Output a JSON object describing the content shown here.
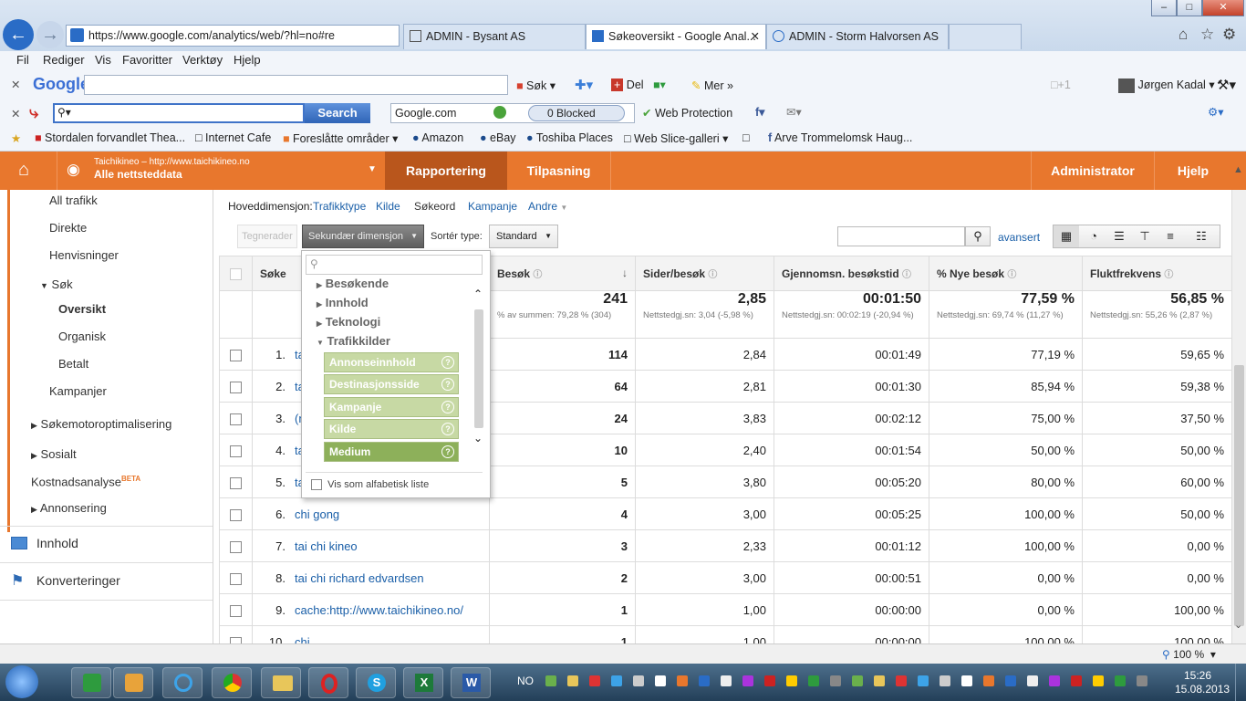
{
  "browser": {
    "address": "https://www.google.com/analytics/web/?hl=no#re",
    "tabs": [
      "ADMIN - Bysant AS",
      "Søkeoversikt - Google Anal...",
      "ADMIN - Storm Halvorsen AS"
    ],
    "menu": [
      "Fil",
      "Rediger",
      "Vis",
      "Favoritter",
      "Verktøy",
      "Hjelp"
    ],
    "google_toolbar": {
      "logo": "Google",
      "search_label": "Søk",
      "share": "Del",
      "more": "Mer",
      "user": "Jørgen Kadal"
    },
    "avg_toolbar": {
      "search_button": "Search",
      "engine": "Google.com",
      "blocked": "0 Blocked",
      "web_protection": "Web Protection"
    },
    "favorites": [
      "Stordalen forvandlet Thea...",
      "Internet Cafe",
      "Foreslåtte områder",
      "Amazon",
      "eBay",
      "Toshiba Places",
      "Web Slice-galleri",
      "Arve Trommelomsk Haug..."
    ]
  },
  "ga_header": {
    "site_line1": "Taichikineo – http://www.taichikineo.no",
    "site_line2": "Alle nettsteddata",
    "tabs": [
      "Rapportering",
      "Tilpasning"
    ],
    "right_tabs": [
      "Administrator",
      "Hjelp"
    ]
  },
  "sidebar": {
    "items": [
      "All trafikk",
      "Direkte",
      "Henvisninger",
      "Søk",
      "Oversikt",
      "Organisk",
      "Betalt",
      "Kampanjer",
      "Søkemotoroptimalisering",
      "Sosialt",
      "Kostnadsanalyse",
      "Annonsering",
      "Innhold",
      "Konverteringer"
    ],
    "beta": "BETA"
  },
  "primary_dim": {
    "label": "Hoveddimensjon:",
    "options": [
      "Trafikktype",
      "Kilde",
      "Søkeord",
      "Kampanje",
      "Andre"
    ]
  },
  "controls": {
    "plot_rows": "Tegnerader",
    "secondary_dim": "Sekundær dimensjon",
    "sort_label": "Sortér type:",
    "sort_value": "Standard",
    "advanced": "avansert"
  },
  "dropdown": {
    "groups": [
      "Besøkende",
      "Innhold",
      "Teknologi",
      "Trafikkilder"
    ],
    "subitems": [
      "Annonseinnhold",
      "Destinasjonsside",
      "Kampanje",
      "Kilde",
      "Medium"
    ],
    "alpha_list": "Vis som alfabetisk liste"
  },
  "table": {
    "headers": [
      "Søke",
      "Besøk",
      "Sider/besøk",
      "Gjennomsn. besøkstid",
      "% Nye besøk",
      "Fluktfrekvens"
    ],
    "totals": [
      {
        "big": "241",
        "small": "% av summen: 79,28 % (304)"
      },
      {
        "big": "2,85",
        "small": "Nettstedgj.sn: 3,04 (-5,98 %)"
      },
      {
        "big": "00:01:50",
        "small": "Nettstedgj.sn: 00:02:19 (-20,94 %)"
      },
      {
        "big": "77,59 %",
        "small": "Nettstedgj.sn: 69,74 % (11,27 %)"
      },
      {
        "big": "56,85 %",
        "small": "Nettstedgj.sn: 55,26 % (2,87 %)"
      }
    ],
    "rows": [
      {
        "n": "1.",
        "kw": "tai",
        "v": [
          "114",
          "2,84",
          "00:01:49",
          "77,19 %",
          "59,65 %"
        ]
      },
      {
        "n": "2.",
        "kw": "tai",
        "v": [
          "64",
          "2,81",
          "00:01:30",
          "85,94 %",
          "59,38 %"
        ]
      },
      {
        "n": "3.",
        "kw": "(n",
        "v": [
          "24",
          "3,83",
          "00:02:12",
          "75,00 %",
          "37,50 %"
        ]
      },
      {
        "n": "4.",
        "kw": "tai",
        "v": [
          "10",
          "2,40",
          "00:01:54",
          "50,00 %",
          "50,00 %"
        ]
      },
      {
        "n": "5.",
        "kw": "tai",
        "v": [
          "5",
          "3,80",
          "00:05:20",
          "80,00 %",
          "60,00 %"
        ]
      },
      {
        "n": "6.",
        "kw": "chi gong",
        "v": [
          "4",
          "3,00",
          "00:05:25",
          "100,00 %",
          "50,00 %"
        ]
      },
      {
        "n": "7.",
        "kw": "tai chi kineo",
        "v": [
          "3",
          "2,33",
          "00:01:12",
          "100,00 %",
          "0,00 %"
        ]
      },
      {
        "n": "8.",
        "kw": "tai chi richard edvardsen",
        "v": [
          "2",
          "3,00",
          "00:00:51",
          "0,00 %",
          "0,00 %"
        ]
      },
      {
        "n": "9.",
        "kw": "cache:http://www.taichikineo.no/",
        "v": [
          "1",
          "1,00",
          "00:00:00",
          "0,00 %",
          "100,00 %"
        ]
      },
      {
        "n": "10.",
        "kw": "chi",
        "v": [
          "1",
          "1,00",
          "00:00:00",
          "100,00 %",
          "100,00 %"
        ]
      }
    ]
  },
  "statusbar": {
    "zoom": "100 %"
  },
  "taskbar": {
    "lang": "NO",
    "time": "15:26",
    "date": "15.08.2013"
  }
}
